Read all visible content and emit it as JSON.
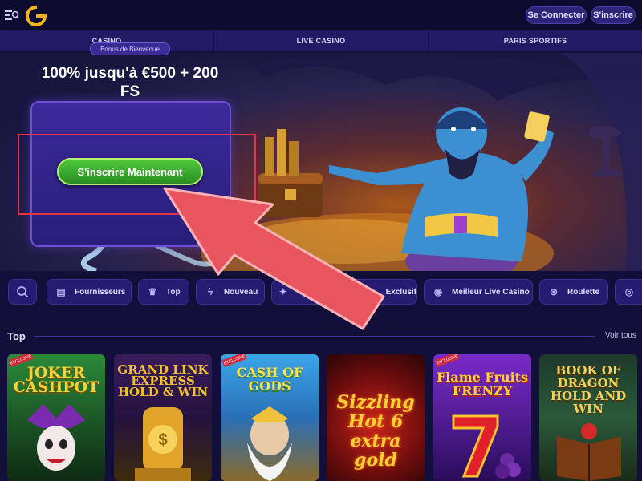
{
  "header": {
    "login_label": "Se Connecter",
    "register_label": "S'inscrire"
  },
  "nav": {
    "items": [
      "CASINO",
      "LIVE CASINO",
      "PARIS SPORTIFS"
    ]
  },
  "hero": {
    "bonus_tab": "Bonus de Bienvenue",
    "bonus_text": "100% jusqu'à €500 + 200 FS",
    "cta_label": "S'inscrire Maintenant"
  },
  "categories": [
    {
      "icon": "search-icon",
      "label": ""
    },
    {
      "icon": "providers-icon",
      "label": "Fournisseurs"
    },
    {
      "icon": "crown-icon",
      "label": "Top"
    },
    {
      "icon": "lightning-icon",
      "label": "Nouveau"
    },
    {
      "icon": "star-icon",
      "label": "Exclusif"
    },
    {
      "icon": "live-icon",
      "label": "Meilleur Live Casino"
    },
    {
      "icon": "roulette-icon",
      "label": "Roulette"
    }
  ],
  "top_section": {
    "title": "Top",
    "see_all": "Voir tous"
  },
  "games": [
    {
      "title": "JOKER CASHPOT",
      "badge": "EXCLUSIVE"
    },
    {
      "title": "GRAND LINK EXPRESS HOLD & WIN",
      "badge": ""
    },
    {
      "title": "CASH OF GODS",
      "badge": "EXCLUSIVE"
    },
    {
      "title": "Sizzling Hot 6 extra gold",
      "badge": ""
    },
    {
      "title": "Flame Fruits FRENZY",
      "badge": "EXCLUSIVE"
    },
    {
      "title": "BOOK OF DRAGON HOLD AND WIN",
      "badge": ""
    }
  ],
  "colors": {
    "background": "#120f3a",
    "nav": "#221c66",
    "cta_green": "#3fb52f",
    "highlight_red": "#e5344a"
  }
}
